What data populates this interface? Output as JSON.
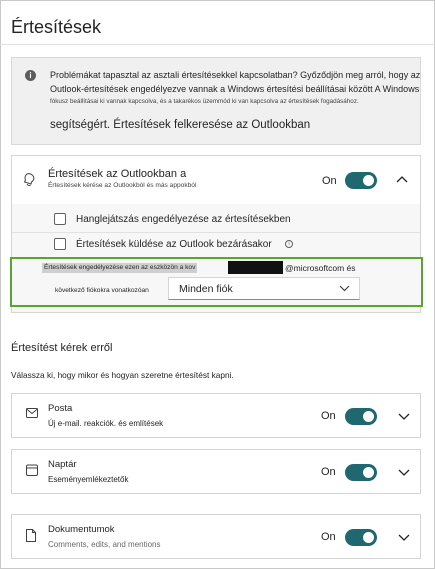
{
  "page": {
    "title": "Értesítések"
  },
  "info_banner": {
    "line1": "Problémákat tapasztal az asztali értesítésekkel kapcsolatban? Győződjön meg arról, hogy az",
    "line2": "Outlook-értesítések engedélyezve vannak a Windows értesítési beállításai között A Windows",
    "line3": "fókusz beállításai ki vannak kapcsolva, és a takarékos üzemmód ki van kapcsolva az értesítések fogadásához.",
    "line4": "segítségért. Értesítések felkeresése az Outlookban"
  },
  "outlook_notifications": {
    "title": "Értesítések az Outlookban a",
    "subtitle": "Értesítések kérése az Outlookból és más appokból",
    "toggle_label": "On",
    "options": [
      {
        "label": "Hanglejátszás engedélyezése az értesítésekben",
        "checked": false
      },
      {
        "label": "Értesítések küldése az Outlook bezárásakor",
        "checked": false
      }
    ],
    "device_text": "Értesítések engedélyezése ezen az eszközön a kov",
    "email_domain": "@microsoftcom és",
    "accounts_label": "következő fiókokra vonatkozóan",
    "accounts_select": "Minden fiók"
  },
  "notify_section": {
    "title": "Értesítést kérek erről",
    "description": "Válassza ki, hogy mikor és hogyan szeretne értesítést kapni."
  },
  "categories": [
    {
      "title": "Posta",
      "subtitle": "Új e-mail. reakciók. és említések",
      "toggle_label": "On",
      "icon": "mail-icon"
    },
    {
      "title": "Naptár",
      "subtitle": "Eseményemlékeztetők",
      "toggle_label": "On",
      "icon": "calendar-icon"
    },
    {
      "title": "Dokumentumok",
      "subtitle": "Comments, edits, and mentions",
      "toggle_label": "On",
      "icon": "document-icon"
    }
  ],
  "colors": {
    "toggle_on": "#1f6870",
    "highlight_border": "#5aa434",
    "banner_bg": "#f0f0f0"
  }
}
